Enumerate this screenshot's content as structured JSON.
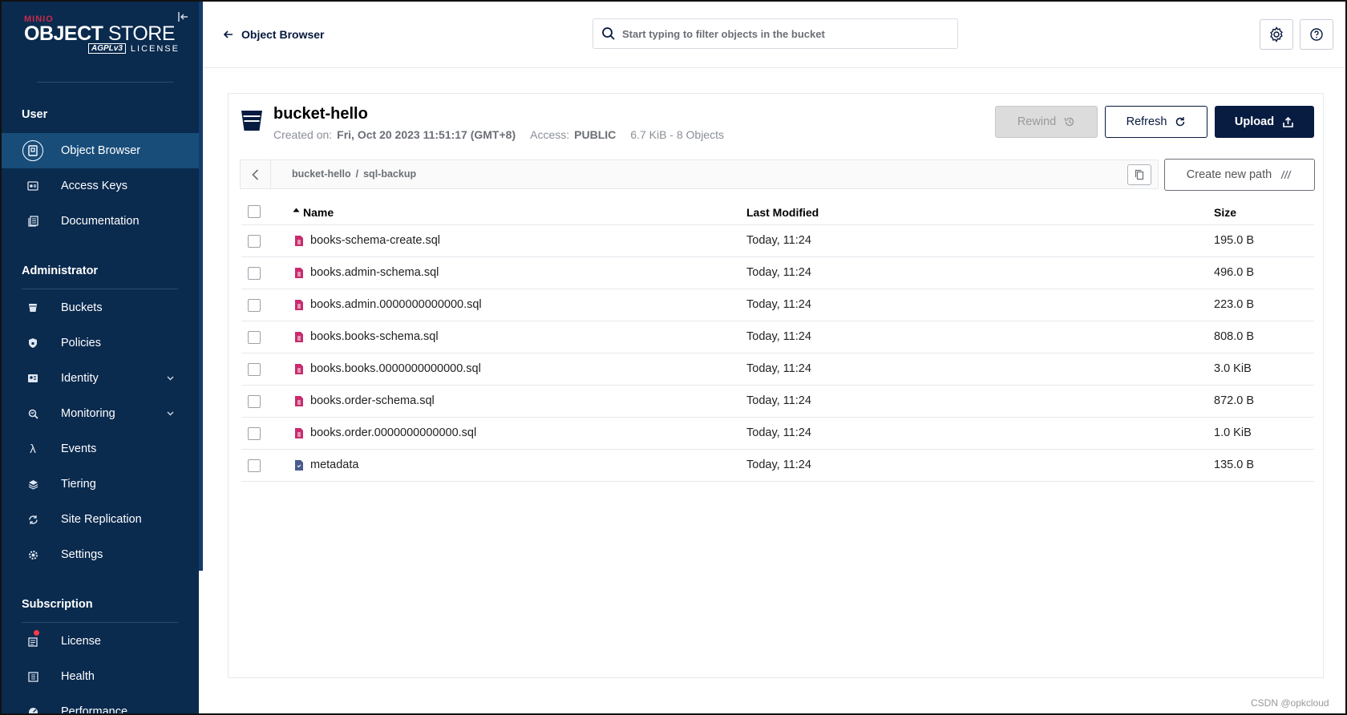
{
  "logo": {
    "brand_top": "MINIO",
    "brand_object": "OBJECT",
    "brand_store": "STORE",
    "agpl": "AGPLv3",
    "license": "LICENSE"
  },
  "sidebar": {
    "sections": [
      {
        "title": "User",
        "items": [
          {
            "label": "Object Browser",
            "icon": "object-browser-icon",
            "active": true
          },
          {
            "label": "Access Keys",
            "icon": "access-keys-icon"
          },
          {
            "label": "Documentation",
            "icon": "documentation-icon"
          }
        ]
      },
      {
        "title": "Administrator",
        "items": [
          {
            "label": "Buckets",
            "icon": "buckets-icon"
          },
          {
            "label": "Policies",
            "icon": "policies-icon"
          },
          {
            "label": "Identity",
            "icon": "identity-icon",
            "expandable": true
          },
          {
            "label": "Monitoring",
            "icon": "monitoring-icon",
            "expandable": true
          },
          {
            "label": "Events",
            "icon": "lambda-icon"
          },
          {
            "label": "Tiering",
            "icon": "tiering-icon"
          },
          {
            "label": "Site Replication",
            "icon": "replication-icon"
          },
          {
            "label": "Settings",
            "icon": "settings-icon"
          }
        ]
      },
      {
        "title": "Subscription",
        "items": [
          {
            "label": "License",
            "icon": "license-icon"
          },
          {
            "label": "Health",
            "icon": "health-icon"
          },
          {
            "label": "Performance",
            "icon": "performance-icon"
          }
        ]
      }
    ]
  },
  "header": {
    "back_label": "Object Browser",
    "search_placeholder": "Start typing to filter objects in the bucket"
  },
  "bucket": {
    "name": "bucket-hello",
    "created_label": "Created on:",
    "created_value": "Fri, Oct 20 2023 11:51:17 (GMT+8)",
    "access_label": "Access:",
    "access_value": "PUBLIC",
    "usage": "6.7 KiB - 8 Objects"
  },
  "actions": {
    "rewind": "Rewind",
    "refresh": "Refresh",
    "upload": "Upload",
    "create_path": "Create new path"
  },
  "path": {
    "bucket": "bucket-hello",
    "separator": "/",
    "folder": "sql-backup"
  },
  "table": {
    "columns": {
      "name": "Name",
      "modified": "Last Modified",
      "size": "Size"
    },
    "rows": [
      {
        "name": "books-schema-create.sql",
        "modified": "Today, 11:24",
        "size": "195.0 B",
        "type": "sql"
      },
      {
        "name": "books.admin-schema.sql",
        "modified": "Today, 11:24",
        "size": "496.0 B",
        "type": "sql"
      },
      {
        "name": "books.admin.0000000000000.sql",
        "modified": "Today, 11:24",
        "size": "223.0 B",
        "type": "sql"
      },
      {
        "name": "books.books-schema.sql",
        "modified": "Today, 11:24",
        "size": "808.0 B",
        "type": "sql"
      },
      {
        "name": "books.books.0000000000000.sql",
        "modified": "Today, 11:24",
        "size": "3.0 KiB",
        "type": "sql"
      },
      {
        "name": "books.order-schema.sql",
        "modified": "Today, 11:24",
        "size": "872.0 B",
        "type": "sql"
      },
      {
        "name": "books.order.0000000000000.sql",
        "modified": "Today, 11:24",
        "size": "1.0 KiB",
        "type": "sql"
      },
      {
        "name": "metadata",
        "modified": "Today, 11:24",
        "size": "135.0 B",
        "type": "generic"
      }
    ]
  },
  "watermark": "CSDN @opkcloud",
  "colors": {
    "sidebar": "#0a2a4e",
    "sidebar_active": "#184d7a",
    "upload": "#081c42",
    "sql_icon": "#c72c6e",
    "generic_icon": "#4a5a8c"
  }
}
